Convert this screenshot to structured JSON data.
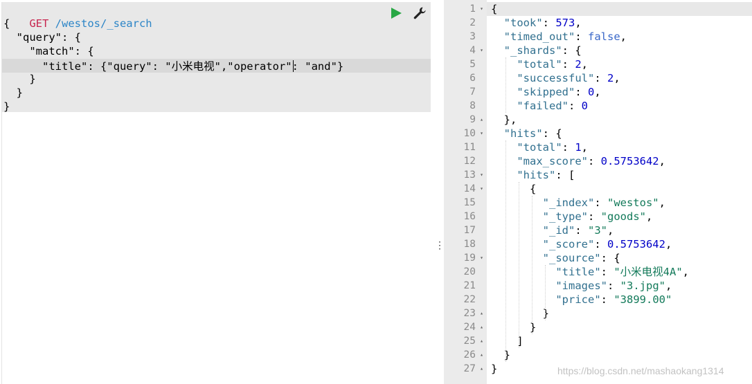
{
  "request": {
    "method": "GET",
    "path": " /westos/_search",
    "lines": [
      "{",
      "  \"query\": {",
      "    \"match\": {",
      "      \"title\": {\"query\": \"小米电视\",\"operator\"",
      ": \"and\"}",
      "    }",
      "  }",
      "}"
    ],
    "icons": {
      "run": "play-icon",
      "settings": "wrench-icon"
    },
    "colors": {
      "method": "#c7254e",
      "path": "#2c85c7",
      "run": "#29a745"
    }
  },
  "splitter": {
    "handle": "⋮"
  },
  "response": {
    "lines": [
      [
        [
          "p",
          "{"
        ]
      ],
      [
        [
          "p",
          "  "
        ],
        [
          "k",
          "\"took\""
        ],
        [
          "p",
          ": "
        ],
        [
          "n",
          "573"
        ],
        [
          "p",
          ","
        ]
      ],
      [
        [
          "p",
          "  "
        ],
        [
          "k",
          "\"timed_out\""
        ],
        [
          "p",
          ": "
        ],
        [
          "b",
          "false"
        ],
        [
          "p",
          ","
        ]
      ],
      [
        [
          "p",
          "  "
        ],
        [
          "k",
          "\"_shards\""
        ],
        [
          "p",
          ": {"
        ]
      ],
      [
        [
          "p",
          "    "
        ],
        [
          "k",
          "\"total\""
        ],
        [
          "p",
          ": "
        ],
        [
          "n",
          "2"
        ],
        [
          "p",
          ","
        ]
      ],
      [
        [
          "p",
          "    "
        ],
        [
          "k",
          "\"successful\""
        ],
        [
          "p",
          ": "
        ],
        [
          "n",
          "2"
        ],
        [
          "p",
          ","
        ]
      ],
      [
        [
          "p",
          "    "
        ],
        [
          "k",
          "\"skipped\""
        ],
        [
          "p",
          ": "
        ],
        [
          "n",
          "0"
        ],
        [
          "p",
          ","
        ]
      ],
      [
        [
          "p",
          "    "
        ],
        [
          "k",
          "\"failed\""
        ],
        [
          "p",
          ": "
        ],
        [
          "n",
          "0"
        ]
      ],
      [
        [
          "p",
          "  },"
        ]
      ],
      [
        [
          "p",
          "  "
        ],
        [
          "k",
          "\"hits\""
        ],
        [
          "p",
          ": {"
        ]
      ],
      [
        [
          "p",
          "    "
        ],
        [
          "k",
          "\"total\""
        ],
        [
          "p",
          ": "
        ],
        [
          "n",
          "1"
        ],
        [
          "p",
          ","
        ]
      ],
      [
        [
          "p",
          "    "
        ],
        [
          "k",
          "\"max_score\""
        ],
        [
          "p",
          ": "
        ],
        [
          "n",
          "0.5753642"
        ],
        [
          "p",
          ","
        ]
      ],
      [
        [
          "p",
          "    "
        ],
        [
          "k",
          "\"hits\""
        ],
        [
          "p",
          ": ["
        ]
      ],
      [
        [
          "p",
          "      {"
        ]
      ],
      [
        [
          "p",
          "        "
        ],
        [
          "k",
          "\"_index\""
        ],
        [
          "p",
          ": "
        ],
        [
          "s",
          "\"westos\""
        ],
        [
          "p",
          ","
        ]
      ],
      [
        [
          "p",
          "        "
        ],
        [
          "k",
          "\"_type\""
        ],
        [
          "p",
          ": "
        ],
        [
          "s",
          "\"goods\""
        ],
        [
          "p",
          ","
        ]
      ],
      [
        [
          "p",
          "        "
        ],
        [
          "k",
          "\"_id\""
        ],
        [
          "p",
          ": "
        ],
        [
          "s",
          "\"3\""
        ],
        [
          "p",
          ","
        ]
      ],
      [
        [
          "p",
          "        "
        ],
        [
          "k",
          "\"_score\""
        ],
        [
          "p",
          ": "
        ],
        [
          "n",
          "0.5753642"
        ],
        [
          "p",
          ","
        ]
      ],
      [
        [
          "p",
          "        "
        ],
        [
          "k",
          "\"_source\""
        ],
        [
          "p",
          ": {"
        ]
      ],
      [
        [
          "p",
          "          "
        ],
        [
          "k",
          "\"title\""
        ],
        [
          "p",
          ": "
        ],
        [
          "s",
          "\"小米电视4A\""
        ],
        [
          "p",
          ","
        ]
      ],
      [
        [
          "p",
          "          "
        ],
        [
          "k",
          "\"images\""
        ],
        [
          "p",
          ": "
        ],
        [
          "s",
          "\"3.jpg\""
        ],
        [
          "p",
          ","
        ]
      ],
      [
        [
          "p",
          "          "
        ],
        [
          "k",
          "\"price\""
        ],
        [
          "p",
          ": "
        ],
        [
          "s",
          "\"3899.00\""
        ]
      ],
      [
        [
          "p",
          "        }"
        ]
      ],
      [
        [
          "p",
          "      }"
        ]
      ],
      [
        [
          "p",
          "    ]"
        ]
      ],
      [
        [
          "p",
          "  }"
        ]
      ],
      [
        [
          "p",
          "}"
        ]
      ]
    ],
    "line_numbers": [
      "1",
      "2",
      "3",
      "4",
      "5",
      "6",
      "7",
      "8",
      "9",
      "10",
      "11",
      "12",
      "13",
      "14",
      "15",
      "16",
      "17",
      "18",
      "19",
      "20",
      "21",
      "22",
      "23",
      "24",
      "25",
      "26",
      "27"
    ],
    "folds": [
      "▾",
      "",
      "",
      "▾",
      "",
      "",
      "",
      "",
      "▴",
      "▾",
      "",
      "",
      "▾",
      "▾",
      "",
      "",
      "",
      "",
      "▾",
      "",
      "",
      "",
      "▴",
      "▴",
      "▴",
      "▴",
      "▴"
    ]
  },
  "watermark": "https://blog.csdn.net/mashaokang1314"
}
